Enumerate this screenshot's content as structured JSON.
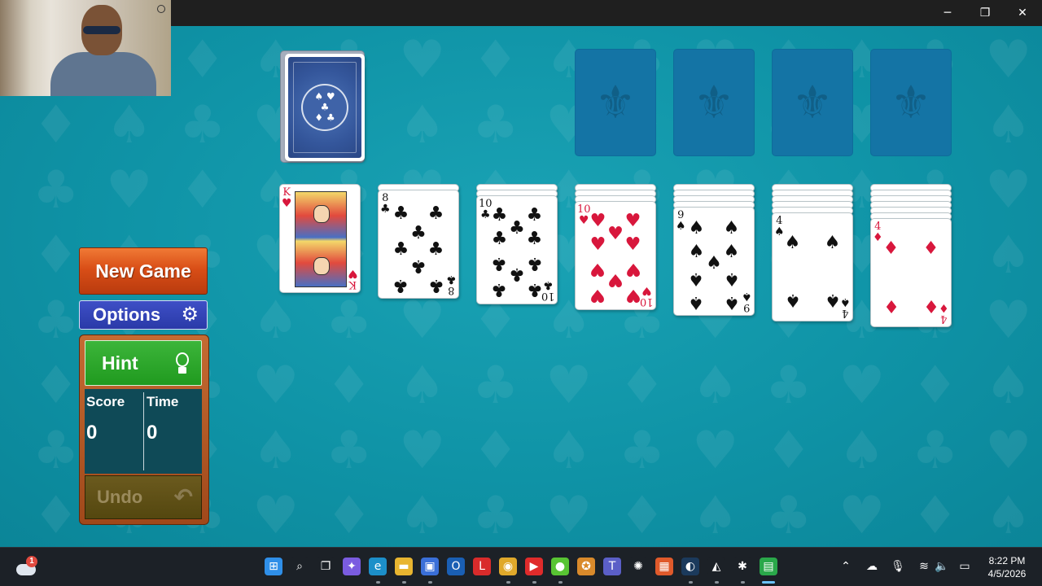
{
  "window": {
    "controls": {
      "minimize": "─",
      "maximize": "❐",
      "close": "✕"
    }
  },
  "game": {
    "buttons": {
      "new_game": "New Game",
      "options": "Options",
      "hint": "Hint",
      "undo": "Undo"
    },
    "stats": {
      "score_label": "Score",
      "score_value": "0",
      "time_label": "Time",
      "time_value": "0"
    },
    "stock": {
      "suits_top": "♠ ♥",
      "suits_bottom": "♦ ♣",
      "center": "♣"
    },
    "foundation_symbol": "⚜",
    "tableau": [
      {
        "rank": "K",
        "suit": "♥",
        "color": "red",
        "hidden": 0
      },
      {
        "rank": "8",
        "suit": "♣",
        "color": "black",
        "hidden": 1
      },
      {
        "rank": "10",
        "suit": "♣",
        "color": "black",
        "hidden": 2
      },
      {
        "rank": "10",
        "suit": "♥",
        "color": "red",
        "hidden": 3
      },
      {
        "rank": "9",
        "suit": "♠",
        "color": "black",
        "hidden": 4
      },
      {
        "rank": "4",
        "suit": "♠",
        "color": "black",
        "hidden": 5
      },
      {
        "rank": "4",
        "suit": "♦",
        "color": "red",
        "hidden": 6
      }
    ]
  },
  "taskbar": {
    "widget_badge": "1",
    "apps": [
      {
        "name": "start",
        "glyph": "⊞",
        "color": "#2f8fe8"
      },
      {
        "name": "search",
        "glyph": "⌕",
        "color": "#1c2127"
      },
      {
        "name": "task-view",
        "glyph": "❐",
        "color": "#1c2127"
      },
      {
        "name": "copilot",
        "glyph": "✦",
        "color": "#7a5ce0"
      },
      {
        "name": "edge",
        "glyph": "e",
        "color": "#1c8fc9"
      },
      {
        "name": "file-explorer",
        "glyph": "▬",
        "color": "#e8b530"
      },
      {
        "name": "store",
        "glyph": "▣",
        "color": "#3a6fd8"
      },
      {
        "name": "outlook",
        "glyph": "O",
        "color": "#1a5fb4"
      },
      {
        "name": "l-app",
        "glyph": "L",
        "color": "#d92b2b"
      },
      {
        "name": "chrome",
        "glyph": "◉",
        "color": "#e0a92b"
      },
      {
        "name": "youtube",
        "glyph": "▶",
        "color": "#e02b2b"
      },
      {
        "name": "duolingo",
        "glyph": "●",
        "color": "#58c433"
      },
      {
        "name": "medal-app",
        "glyph": "✪",
        "color": "#d98a2b"
      },
      {
        "name": "teams",
        "glyph": "T",
        "color": "#5b5fc7"
      },
      {
        "name": "chatgpt",
        "glyph": "✺",
        "color": "#1c2127"
      },
      {
        "name": "microsoft-apps",
        "glyph": "▦",
        "color": "#e05a2b"
      },
      {
        "name": "steam",
        "glyph": "◐",
        "color": "#1b3a5c"
      },
      {
        "name": "unity",
        "glyph": "◭",
        "color": "#1c2127"
      },
      {
        "name": "puzzle-app",
        "glyph": "✱",
        "color": "#1c2127"
      },
      {
        "name": "solitaire",
        "glyph": "▤",
        "color": "#2aa84a"
      }
    ],
    "tray": {
      "chevron": "⌃",
      "onedrive": "☁",
      "mic": "🎙",
      "wifi": "≋",
      "volume": "🔈",
      "battery": "▭"
    },
    "time": "8:22 PM",
    "date": "4/5/2026"
  }
}
